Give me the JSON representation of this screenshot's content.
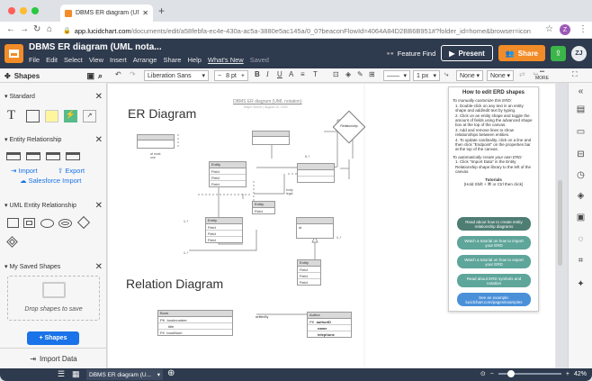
{
  "browser": {
    "tab_title": "DBMS ER diagram (UML notat...",
    "url_host": "app.lucidchart.com",
    "url_path": "/documents/edit/a58febfa-ec4e-430a-ac5a-3880e5ac145a/0_0?beaconFlowId=4064A84D2BB6B951#?folder_id=home&browser=icon",
    "profile_initial": "Z"
  },
  "app": {
    "doc_title": "DBMS ER diagram (UML nota...",
    "menus": [
      "File",
      "Edit",
      "Select",
      "View",
      "Insert",
      "Arrange",
      "Share",
      "Help"
    ],
    "whats_new": "What's New",
    "saved": "Saved",
    "feature_find": "Feature Find",
    "present": "Present",
    "share": "Share",
    "user_initials": "ZJ"
  },
  "toolbar": {
    "shapes_label": "Shapes",
    "font": "Liberation Sans",
    "font_size": "8 pt",
    "stroke_width": "1 px",
    "arrow_start": "None",
    "arrow_end": "None",
    "more": "MORE"
  },
  "left": {
    "standard": "Standard",
    "entity_relationship": "Entity Relationship",
    "import": "Import",
    "export": "Export",
    "salesforce_import": "Salesforce Import",
    "uml_entity": "UML Entity Relationship",
    "my_saved": "My Saved Shapes",
    "drop_text": "Drop shapes to save",
    "shapes_button": "+ Shapes",
    "import_data": "Import Data"
  },
  "canvas": {
    "er_title": "ER Diagram",
    "rel_title": "Relation Diagram",
    "doc_caption": "DBMS ER diagram (UML notation)",
    "doc_sub": "Ralph Stoner | August 20, 2020",
    "relationship_label": "Relationship",
    "entity": "Entity",
    "field": "Field",
    "id": "id",
    "book": "Book",
    "author": "Author",
    "authorID": "authorID",
    "name": "name",
    "telephone": "telephone",
    "pk": "PK",
    "fk": "FK",
    "title": "title",
    "booknumber": "booknumber",
    "bookNum": "bookNum",
    "writtenBy": "writtenBy"
  },
  "help": {
    "title": "How to edit ERD shapes",
    "customize_head": "To manually customize this ERD:",
    "steps": [
      "Double-click on any text in an entity shape and add/edit text by typing.",
      "Click on an entity shape and toggle the amount of fields using the advanced shape box at the top of the canvas.",
      "Add and remove lines to show relationships between entities.",
      "To update cardinality, click on a line and then click \"Endpoint\" on the properties bar at the top of the canvas."
    ],
    "auto_head": "To automatically create your own ERD:",
    "auto_step": "Click \"Import Data\" in the Entity Relationship shape library to the left of the canvas.",
    "tutorials": "Tutorials",
    "tutorials_sub": "(Hold Shift + ⌘ or Ctrl then click)",
    "buttons": [
      "Read about how to create entity relationship diagrams",
      "Watch a tutorial on how to import your ERD",
      "Watch a tutorial on how to export your ERD",
      "Read about ERD symbols and notation",
      "See an example: lucidchart.com/pages/examples"
    ],
    "colors": [
      "#4e7d73",
      "#5ea59a",
      "#5ea59a",
      "#5ea59a",
      "#4a90d9"
    ]
  },
  "bottom": {
    "page_tab": "DBMS ER diagram (U...",
    "zoom": "42%"
  }
}
